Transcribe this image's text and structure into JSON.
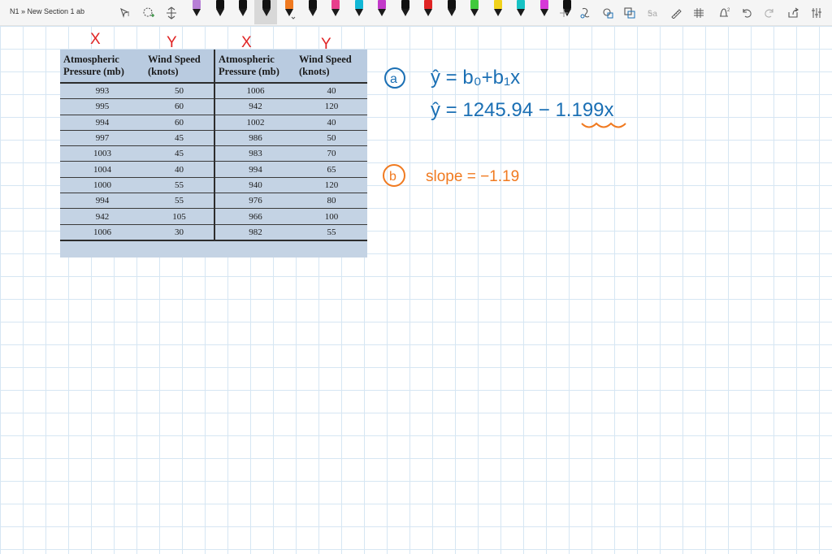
{
  "app": {
    "breadcrumb": "N1 » New Section 1 ab"
  },
  "toolbar": {
    "tools": [
      "lasso-select-icon",
      "add-space-icon",
      "shape-select-icon"
    ],
    "pen_colors": [
      "#b77fd6",
      "#111111",
      "#111111",
      "#111111",
      "#f07a20",
      "#111111",
      "#e83e8c",
      "#11b7d6",
      "#c23ac9",
      "#111111",
      "#e02424",
      "#111111",
      "#41c93d",
      "#f1d21a",
      "#17c2c4",
      "#d63ad8",
      "#111111"
    ],
    "selected_pen_index": 4,
    "right_tools": [
      "add-pen-icon",
      "ink-to-shape-icon",
      "ink-to-text-icon",
      "lasso-icon",
      "ink-math-icon",
      "ruler-icon",
      "ink-replay-icon",
      "touch-writing-icon",
      "undo-icon",
      "redo-icon",
      "share-icon",
      "more-icon"
    ],
    "accent_blue": "#1a6fb4",
    "accent_orange": "#f07a20"
  },
  "table": {
    "headers": [
      [
        "Atmospheric",
        "Pressure (mb)"
      ],
      [
        "Wind Speed",
        "(knots)"
      ],
      [
        "Atmospheric",
        "Pressure (mb)"
      ],
      [
        "Wind Speed",
        "(knots)"
      ]
    ],
    "rows": [
      [
        "993",
        "50",
        "1006",
        "40"
      ],
      [
        "995",
        "60",
        "942",
        "120"
      ],
      [
        "994",
        "60",
        "1002",
        "40"
      ],
      [
        "997",
        "45",
        "986",
        "50"
      ],
      [
        "1003",
        "45",
        "983",
        "70"
      ],
      [
        "1004",
        "40",
        "994",
        "65"
      ],
      [
        "1000",
        "55",
        "940",
        "120"
      ],
      [
        "994",
        "55",
        "976",
        "80"
      ],
      [
        "942",
        "105",
        "966",
        "100"
      ],
      [
        "1006",
        "30",
        "982",
        "55"
      ]
    ]
  },
  "annotations": {
    "column_marks": [
      "X",
      "Y",
      "X",
      "Y"
    ],
    "part_a_label": "a",
    "part_a_line1": "ŷ = b₀+b₁x",
    "part_a_line2": "ŷ = 1245.94 − 1.199x",
    "part_b_label": "b",
    "part_b_text": "slope = −1.19"
  }
}
